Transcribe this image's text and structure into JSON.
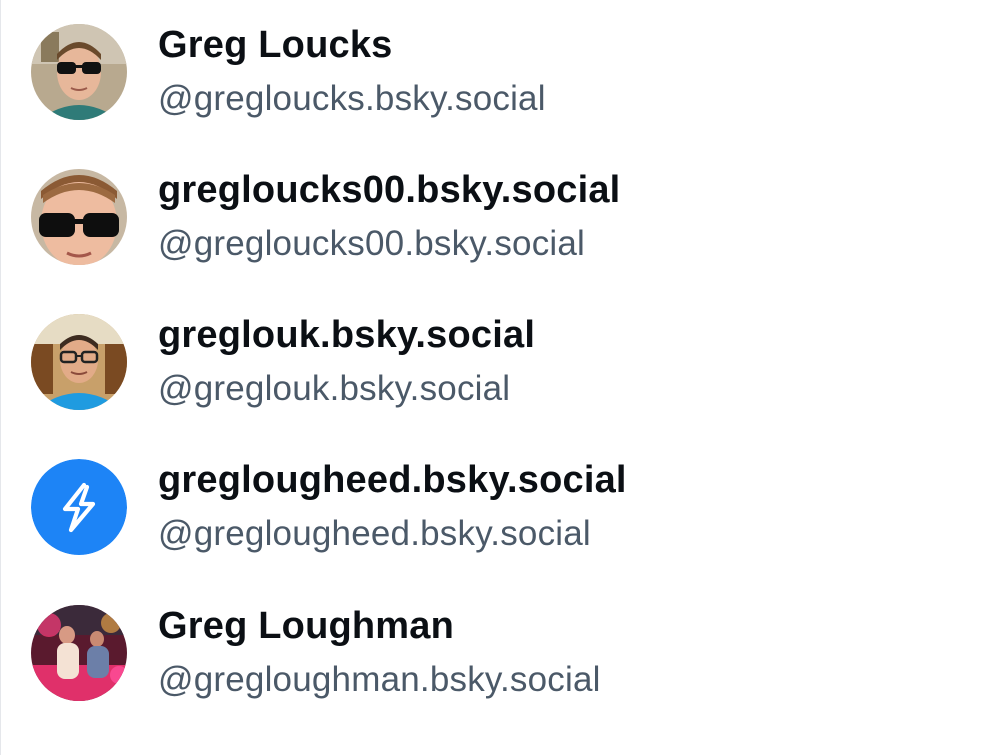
{
  "users": [
    {
      "display_name": "Greg Loucks",
      "handle": "@gregloucks.bsky.social",
      "avatar": "photo-sunglasses"
    },
    {
      "display_name": "gregloucks00.bsky.social",
      "handle": "@gregloucks00.bsky.social",
      "avatar": "photo-sunglasses-closeup"
    },
    {
      "display_name": "greglouk.bsky.social",
      "handle": "@greglouk.bsky.social",
      "avatar": "photo-glasses-blue-shirt"
    },
    {
      "display_name": "greglougheed.bsky.social",
      "handle": "@greglougheed.bsky.social",
      "avatar": "default-avatar-lightning-icon"
    },
    {
      "display_name": "Greg Loughman",
      "handle": "@gregloughman.bsky.social",
      "avatar": "photo-party-pink-lights"
    }
  ],
  "colors": {
    "display_name": "#0b0f14",
    "handle": "#4b5968",
    "default_avatar": "#1d84f6",
    "divider": "#e5e7eb"
  }
}
